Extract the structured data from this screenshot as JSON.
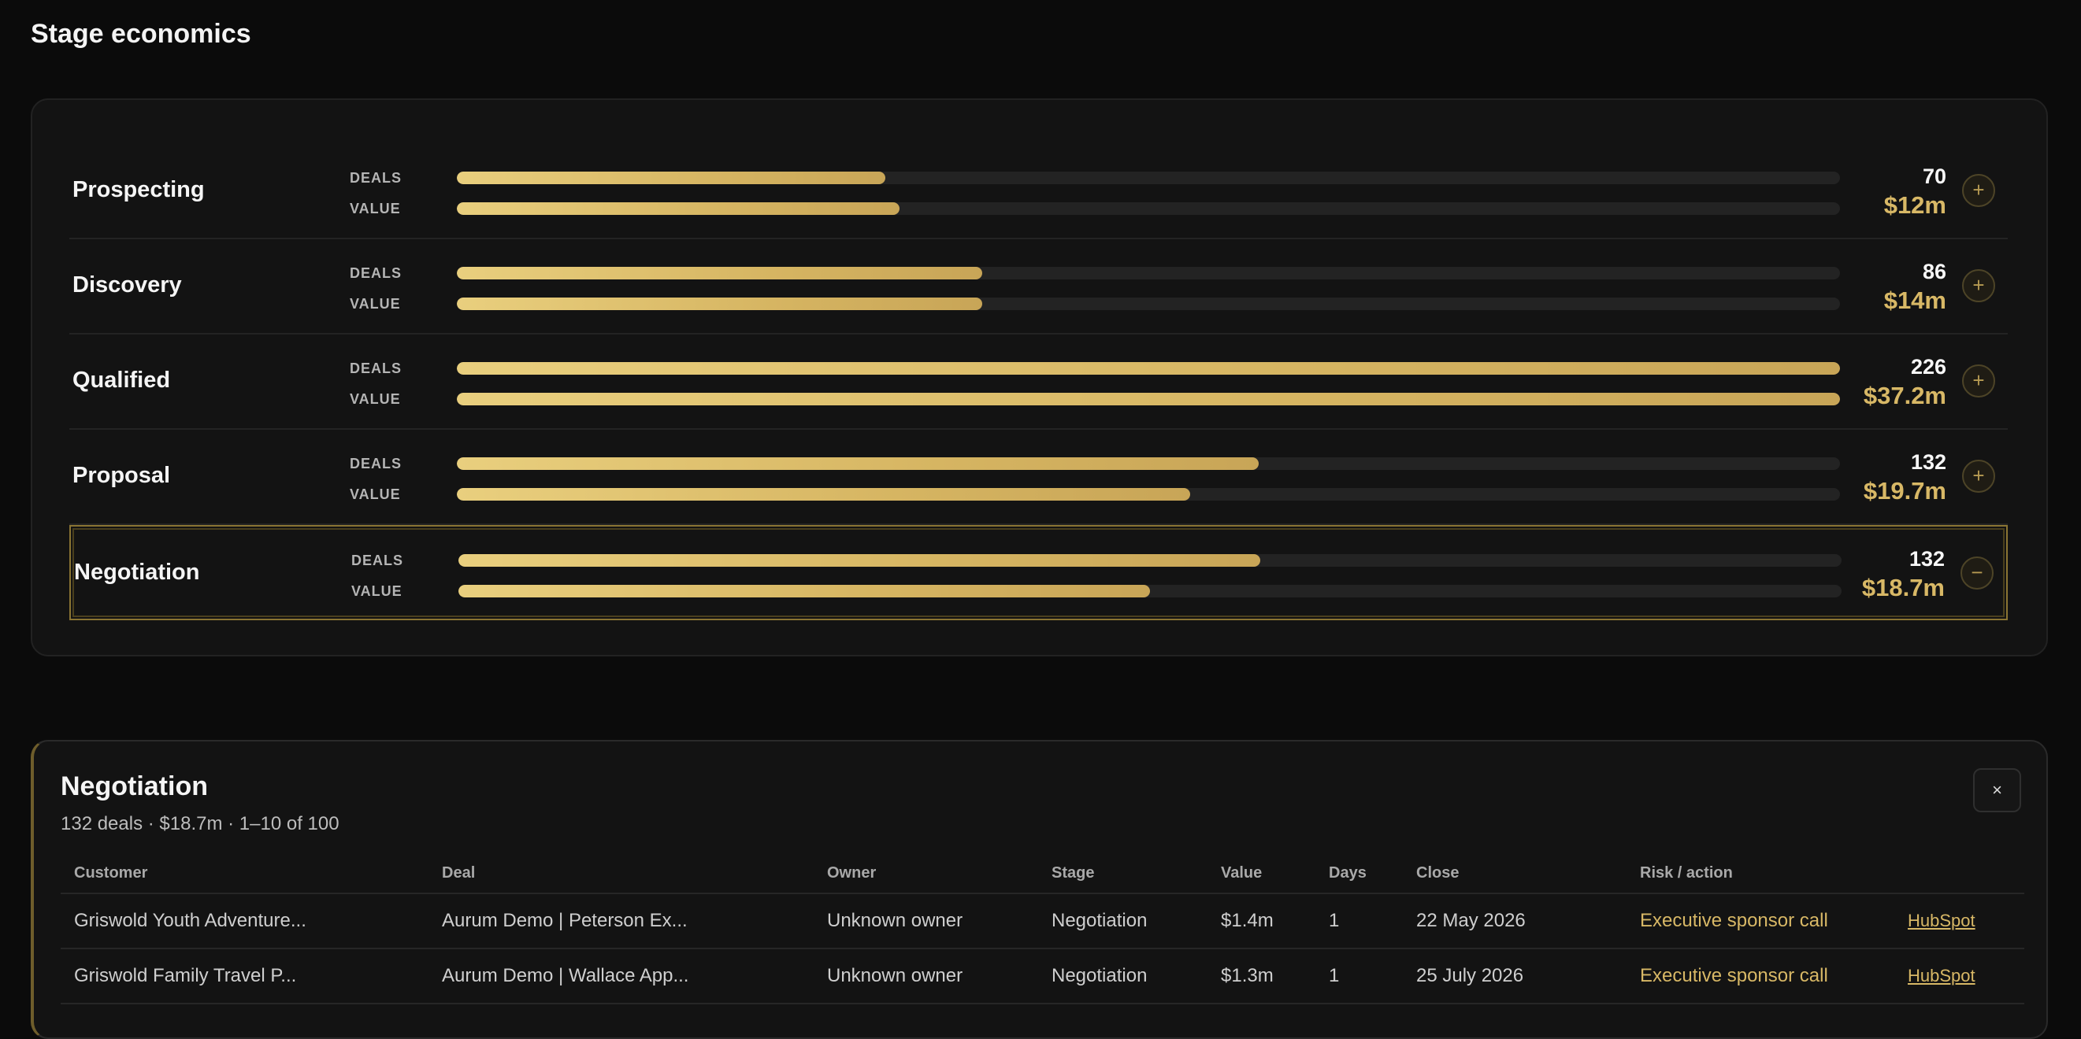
{
  "page": {
    "title": "Stage economics"
  },
  "labels": {
    "deals": "DEALS",
    "value": "VALUE"
  },
  "colors": {
    "accent": "#d8b866",
    "bar_start": "#e9cf7e",
    "bar_end": "#c8a557"
  },
  "stages": [
    {
      "name": "Prospecting",
      "deals": "70",
      "value": "$12m",
      "deals_pct": 31.0,
      "value_pct": 32.0,
      "toggle": "+"
    },
    {
      "name": "Discovery",
      "deals": "86",
      "value": "$14m",
      "deals_pct": 38.0,
      "value_pct": 38.0,
      "toggle": "+"
    },
    {
      "name": "Qualified",
      "deals": "226",
      "value": "$37.2m",
      "deals_pct": 100.0,
      "value_pct": 100.0,
      "toggle": "+"
    },
    {
      "name": "Proposal",
      "deals": "132",
      "value": "$19.7m",
      "deals_pct": 58.0,
      "value_pct": 53.0,
      "toggle": "+"
    },
    {
      "name": "Negotiation",
      "deals": "132",
      "value": "$18.7m",
      "deals_pct": 58.0,
      "value_pct": 50.0,
      "toggle": "−",
      "selected": true
    }
  ],
  "detail": {
    "title": "Negotiation",
    "subtitle": "132 deals · $18.7m · 1–10 of 100",
    "close_label": "×",
    "columns": {
      "customer": "Customer",
      "deal": "Deal",
      "owner": "Owner",
      "stage": "Stage",
      "value": "Value",
      "days": "Days",
      "close": "Close",
      "risk": "Risk / action"
    },
    "rows": [
      {
        "customer": "Griswold Youth Adventure...",
        "deal": "Aurum Demo | Peterson Ex...",
        "owner": "Unknown owner",
        "stage": "Negotiation",
        "value": "$1.4m",
        "days": "1",
        "close": "22 May 2026",
        "risk": "Executive sponsor call",
        "link": "HubSpot"
      },
      {
        "customer": "Griswold Family Travel P...",
        "deal": "Aurum Demo | Wallace App...",
        "owner": "Unknown owner",
        "stage": "Negotiation",
        "value": "$1.3m",
        "days": "1",
        "close": "25 July 2026",
        "risk": "Executive sponsor call",
        "link": "HubSpot"
      }
    ]
  }
}
